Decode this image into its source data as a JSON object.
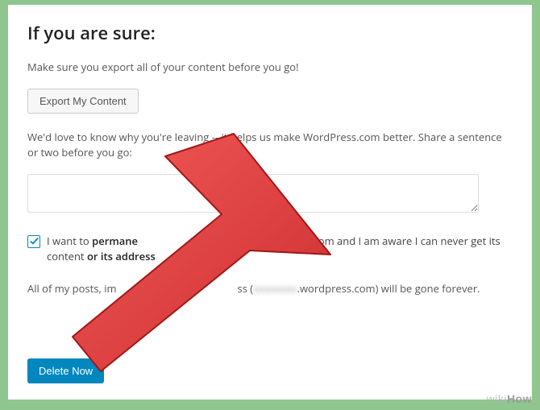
{
  "title": "If you are sure:",
  "intro": "Make sure you export all of your content before you go!",
  "export_button": "Export My Content",
  "feedback_prompt": "We'd love to know why you're leaving -- it helps us make WordPress.com better. Share a sentence or two before you go:",
  "feedback_value": "",
  "confirm": {
    "checked": true,
    "part1": "I want to ",
    "bold1": "permane",
    "gap": " ",
    "part2": "wordpress.com and I am aware I can never get its content ",
    "bold2": "or its address"
  },
  "consequence": {
    "part1": "All of my posts, im",
    "part2": "ss (",
    "blurred_domain": "xxxxxxxx",
    "part3": ".wordpress.com) will be gone forever."
  },
  "delete_button": "Delete Now",
  "watermark": {
    "wiki": "wiki",
    "how": "How"
  }
}
